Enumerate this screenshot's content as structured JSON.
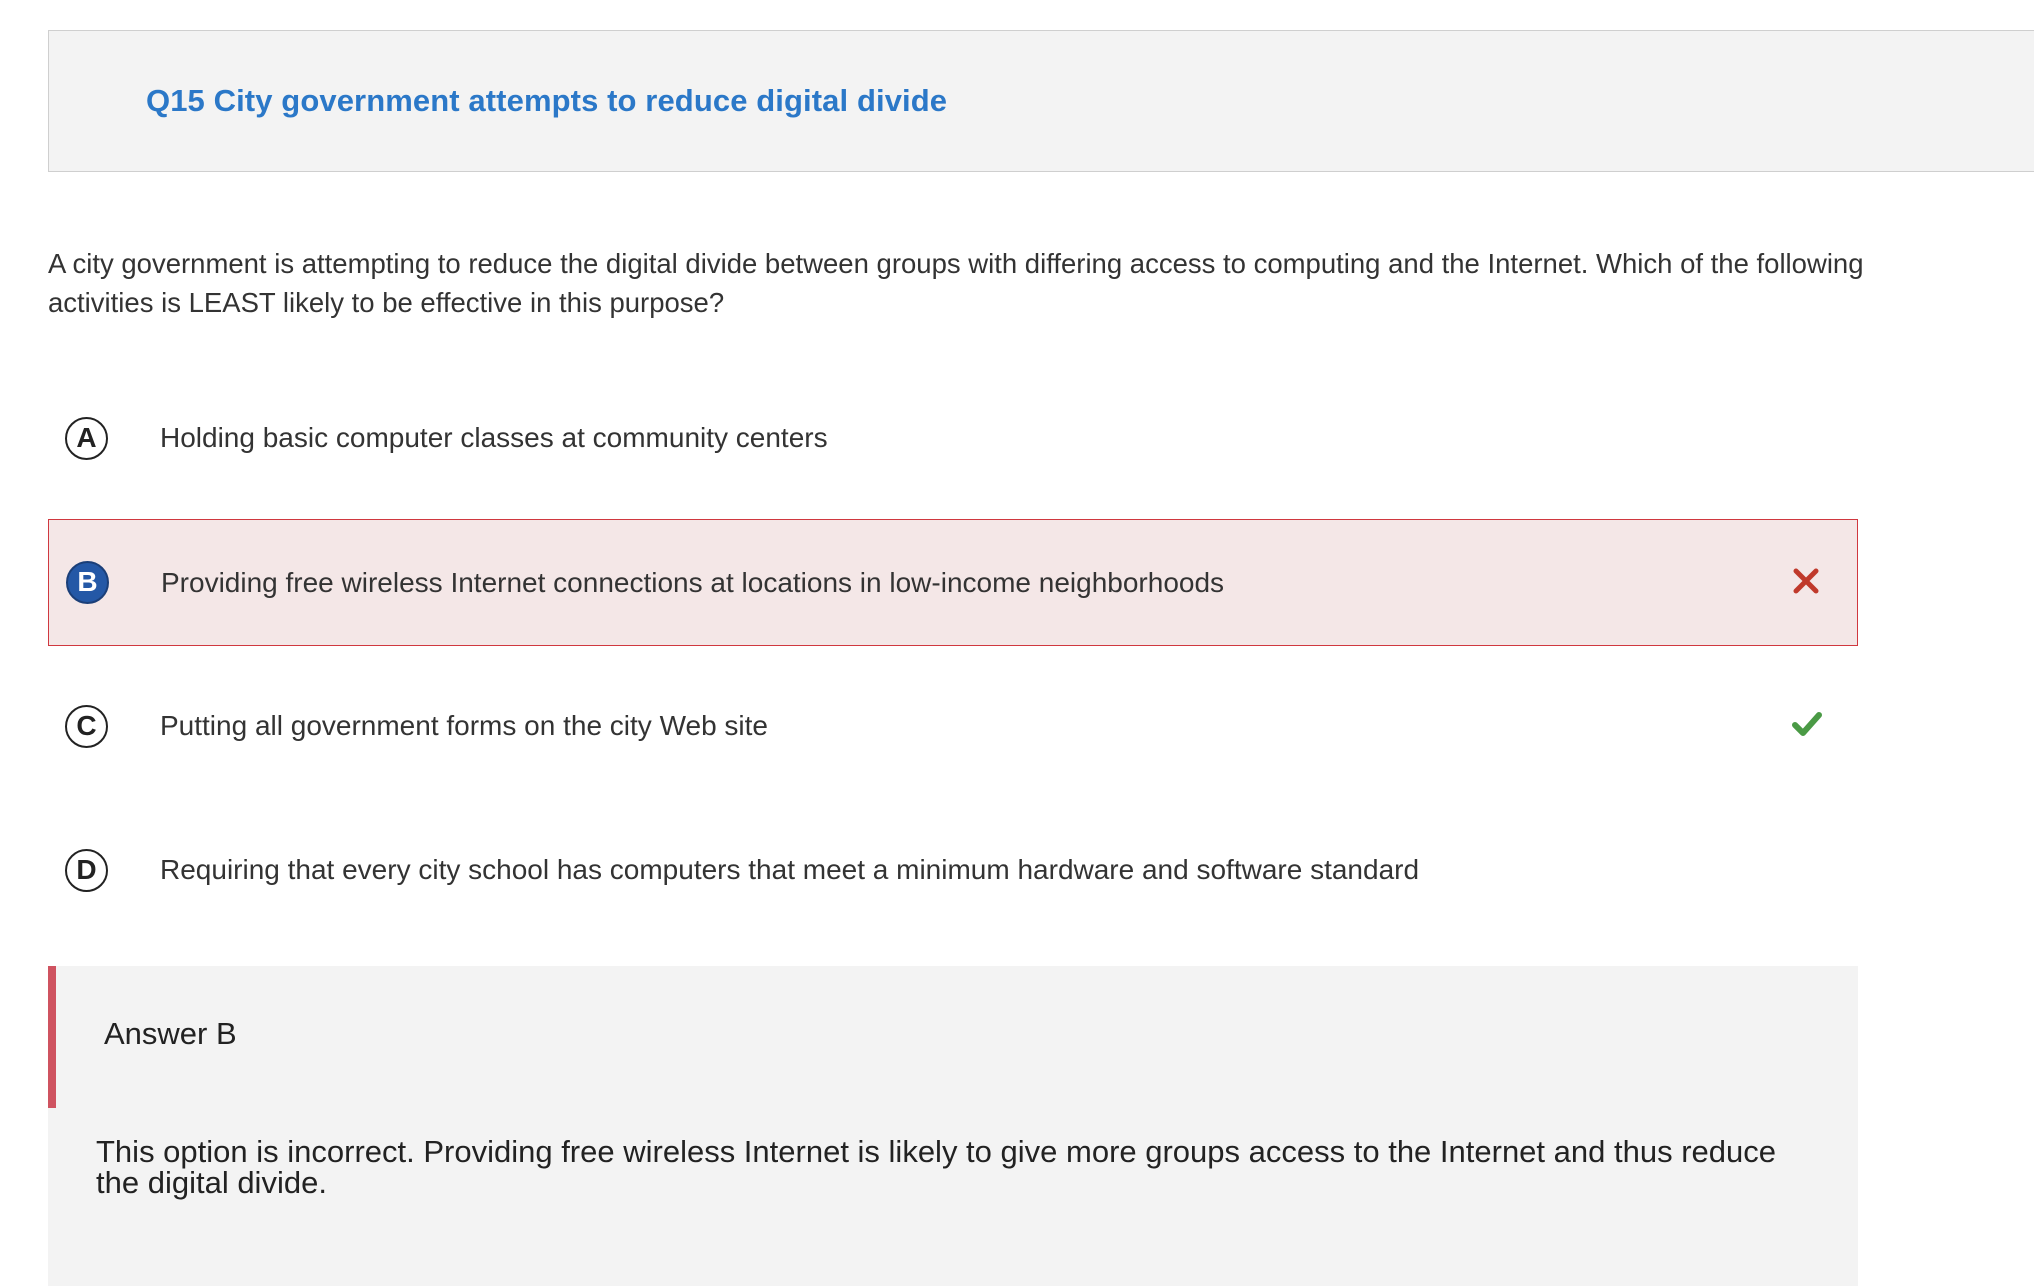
{
  "header": {
    "title": "Q15 City government attempts to reduce digital divide"
  },
  "question": {
    "text": "A city government is attempting to reduce the digital divide between groups with differing access to computing and the Internet. Which of the following activities is LEAST likely to be effective in this purpose?"
  },
  "options": [
    {
      "letter": "A",
      "text": "Holding basic computer classes at community centers",
      "state": "none"
    },
    {
      "letter": "B",
      "text": "Providing free wireless Internet connections at locations in low-income neighborhoods",
      "state": "selected-incorrect",
      "icon": "x-icon",
      "icon_color": "#c0392b"
    },
    {
      "letter": "C",
      "text": "Putting all government forms on the city Web site",
      "state": "correct",
      "icon": "checkmark-icon",
      "icon_color": "#4a9a45"
    },
    {
      "letter": "D",
      "text": "Requiring that every city school has computers that meet a minimum hardware and software standard",
      "state": "none"
    }
  ],
  "feedback": {
    "heading": "Answer B",
    "body": "This option is incorrect. Providing free wireless Internet is likely to give more groups access to the Internet and thus reduce the digital divide."
  },
  "colors": {
    "title": "#2b78c8",
    "selected_bg": "#f4e7e7",
    "selected_border": "#d0383f",
    "selected_letter_bg": "#2458a6",
    "feedback_bar": "#cf5360"
  }
}
